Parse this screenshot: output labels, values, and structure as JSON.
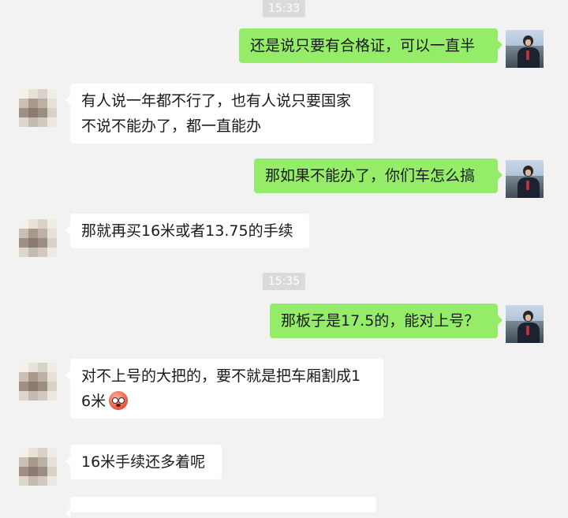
{
  "timestamps": [
    "15:33",
    "15:35"
  ],
  "messages": [
    {
      "side": "right",
      "lines": [
        "还是说只要有合格证，可以一直半"
      ]
    },
    {
      "side": "left",
      "lines": [
        "有人说一年都不行了，也有人说只要国家",
        "不说不能办了，都一直能办"
      ]
    },
    {
      "side": "right",
      "lines": [
        "那如果不能办了，你们车怎么搞"
      ]
    },
    {
      "side": "left",
      "lines": [
        "那就再买16米或者13.75的手续"
      ]
    },
    {
      "side": "right",
      "lines": [
        "那板子是17.5的，能对上号？"
      ]
    },
    {
      "side": "left",
      "lines": [
        "对不上号的大把的，要不就是把车厢割成1",
        "6米"
      ],
      "emoji": "flushed-face-emoji"
    },
    {
      "side": "left",
      "lines": [
        "16米手续还多着呢"
      ]
    }
  ],
  "colors": {
    "background": "#f2f2f2",
    "outgoing_bubble": "#95ec69",
    "incoming_bubble": "#ffffff",
    "timestamp_bg": "#dadada"
  }
}
